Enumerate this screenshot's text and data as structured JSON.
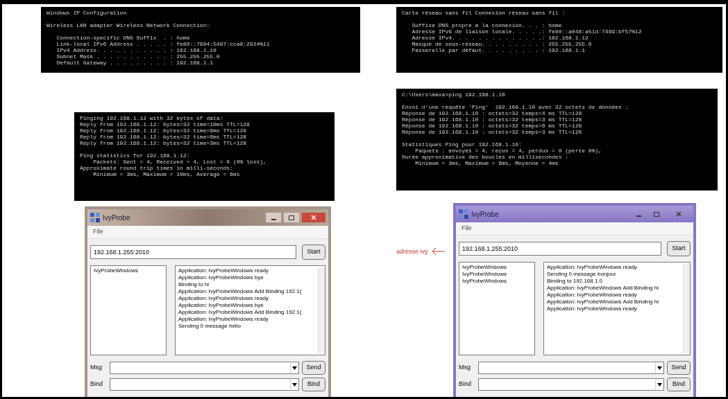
{
  "left": {
    "ipconfig": {
      "blocks": [
        [
          "Windows IP Configuration"
        ],
        [
          "Wireless LAN adapter Wireless Network Connection:"
        ],
        [
          "   Connection-specific DNS Suffix  . : home",
          "   Link-local IPv6 Address . . . . . : fe80::7994:5d97:cca8:2924%11",
          "   IPv4 Address. . . . . . . . . . . : 192.168.1.10",
          "   Subnet Mask . . . . . . . . . . . : 255.255.255.0",
          "   Default Gateway . . . . . . . . . : 192.168.1.1"
        ]
      ]
    },
    "ping": {
      "blocks": [
        [
          "Pinging 192.168.1.12 with 32 bytes of data:",
          "Reply from 192.168.1.12: bytes=32 time=10ms TTL=128",
          "Reply from 192.168.1.12: bytes=32 time=6ms TTL=128",
          "Reply from 192.168.1.12: bytes=32 time=6ms TTL=128",
          "Reply from 192.168.1.12: bytes=32 time=3ms TTL=128"
        ],
        [
          "Ping statistics for 192.168.1.12:",
          "    Packets: Sent = 4, Received = 4, Lost = 0 (0% loss),",
          "Approximate round trip times in milli-seconds:",
          "    Minimum = 3ms, Maximum = 10ms, Average = 6ms"
        ]
      ]
    },
    "ivy_window": {
      "kind": "aero",
      "title": "IvyProbe",
      "menu": [
        "File"
      ],
      "address": "192.168.1.255:2010",
      "start_button": "Start",
      "agents": [
        "IvyProbeWindows"
      ],
      "log": [
        "Application: IvyProbeWindows ready",
        "Application: IvyProbeWindows bye",
        "Binding to hi",
        "Application: IvyProbeWindows Add Binding 192.1(",
        "Application: IvyProbeWindows ready",
        "Application: IvyProbeWindows bye",
        "Application: IvyProbeWindows Add Binding 192.1(",
        "Application: IvyProbeWindows ready",
        "Sending 0 message hello"
      ],
      "msg": {
        "label": "Msg",
        "button": "Send"
      },
      "bind": {
        "label": "Bind",
        "button": "Bind"
      }
    }
  },
  "right": {
    "ipconfig": {
      "blocks": [
        [
          "Carte réseau sans fil Connexion réseau sans fil :"
        ],
        [
          "   Suffixe DNS propre à la connexion. . . : home",
          "   Adresse IPv6 de liaison locale. . . . .: fe80::a048:a51d:7469:bf57%12",
          "   Adresse IPv4. . . . . . . . . . . . . .: 192.168.1.12",
          "   Masque de sous-réseau. . . . . . . . . : 255.255.255.0",
          "   Passerelle par défaut. . . . . . . . . : 192.168.1.1"
        ]
      ]
    },
    "ping": {
      "blocks": [
        [
          "C:\\Users\\maxa>ping 192.168.1.10"
        ],
        [
          "Envoi d'une requête 'Ping'  192.168.1.10 avec 32 octets de données :",
          "Réponse de 192.168.1.10 : octets=32 temps=4 ms TTL=128",
          "Réponse de 192.168.1.10 : octets=32 temps=3 ms TTL=128",
          "Réponse de 192.168.1.10 : octets=32 temps=6 ms TTL=128",
          "Réponse de 192.168.1.10 : octets=32 temps=3 ms TTL=128"
        ],
        [
          "Statistiques Ping pour 192.168.1.10:",
          "    Paquets : envoyés = 4, reçus = 4, perdus = 0 (perte 0%),",
          "Durée approximative des boucles en millisecondes :",
          "    Minimum = 3ms, Maximum = 6ms, Moyenne = 4ms"
        ]
      ]
    },
    "annotation": {
      "label": "adresse ivy"
    },
    "ivy_window": {
      "kind": "purple",
      "title": "IvyProbe",
      "menu": [
        "File"
      ],
      "address": "192.168.1.255:2010",
      "start_button": "Start",
      "agents": [
        "IvyProbeWindows",
        "IvyProbeWindows",
        "IvyProbeWindows"
      ],
      "log": [
        "Application: IvyProbeWindows ready",
        "Sending 0 message bonjour",
        "Binding to 192.168.1.0",
        "Application: IvyProbeWindows Add Binding hi",
        "Application: IvyProbeWindows ready",
        "Application: IvyProbeWindows Add Binding hi",
        "Application: IvyProbeWindows ready"
      ],
      "msg": {
        "label": "Msg",
        "button": "Send"
      },
      "bind": {
        "label": "Bind",
        "button": "Bind"
      }
    }
  }
}
